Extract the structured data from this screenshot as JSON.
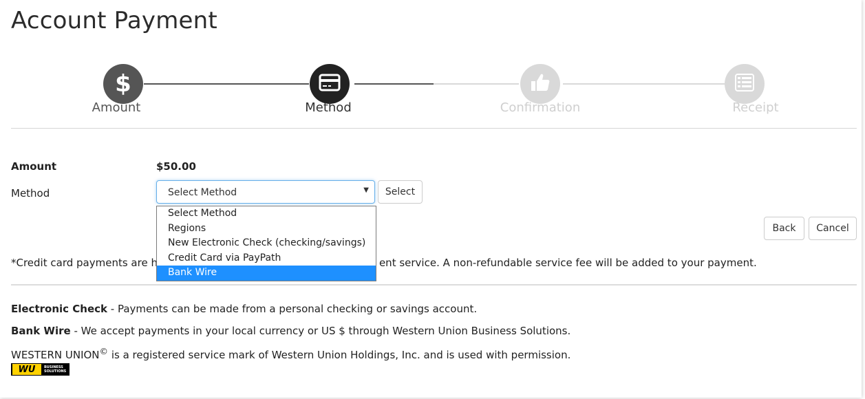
{
  "page": {
    "title": "Account Payment"
  },
  "stepper": {
    "steps": [
      {
        "label": "Amount",
        "state": "complete",
        "icon": "dollar-icon"
      },
      {
        "label": "Method",
        "state": "current",
        "icon": "credit-card-icon"
      },
      {
        "label": "Confirmation",
        "state": "pending",
        "icon": "thumbs-up-icon"
      },
      {
        "label": "Receipt",
        "state": "pending",
        "icon": "list-icon"
      }
    ],
    "colors": {
      "complete": "#555555",
      "current": "#222222",
      "pending": "#d9d9d9"
    }
  },
  "form": {
    "amount_label": "Amount",
    "amount_value": "$50.00",
    "method_label": "Method",
    "method_selected": "Select Method",
    "select_button": "Select",
    "method_options": [
      "Select Method",
      "Regions",
      "New Electronic Check (checking/savings)",
      "Credit Card via PayPath",
      "Bank Wire"
    ],
    "highlighted_option": "Bank Wire"
  },
  "actions": {
    "back": "Back",
    "cancel": "Cancel"
  },
  "note": {
    "left": "*Credit card payments are h",
    "right": "ent service. A non-refundable service fee will be added to your payment."
  },
  "info": {
    "echeck_title": "Electronic Check",
    "echeck_text": " - Payments can be made from a personal checking or savings  account.",
    "wire_title": "Bank Wire",
    "wire_text": " - We accept payments in your local currency or US $ through Western Union Business Solutions.",
    "wu_text_a": "WESTERN UNION",
    "wu_sup": "©",
    "wu_text_b": " is a registered service mark of Western Union Holdings, Inc. and is used with permission."
  },
  "logo": {
    "mark": "WU",
    "line1": "BUSINESS",
    "line2": "SOLUTIONS"
  }
}
